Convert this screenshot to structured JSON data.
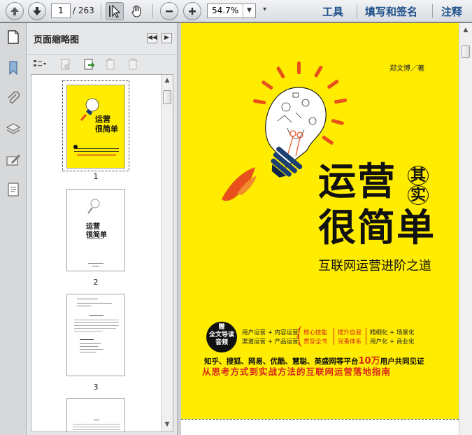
{
  "toolbar": {
    "current_page": "1",
    "page_total": "/ 263",
    "zoom": "54.7%",
    "tools_label": "工具",
    "sign_label": "填写和签名",
    "comment_label": "注释"
  },
  "panel": {
    "title": "页面缩略图",
    "thumbnails": [
      {
        "number": "1"
      },
      {
        "number": "2"
      },
      {
        "number": "3"
      }
    ],
    "thumb1_title_a": "运营",
    "thumb1_title_b": "很简单",
    "thumb2_title_a": "运营",
    "thumb2_title_b": "很简单"
  },
  "cover": {
    "author": "郑文博／著",
    "title_line1": "运营",
    "title_qi": "其",
    "title_shi": "实",
    "title_line2": "很简单",
    "subtitle": "互联网运营进阶之道",
    "badge_line1": "赠",
    "badge_line2": "全文导读",
    "badge_line3": "音频",
    "feature_left_1": "用户运营 + 内容运营",
    "feature_left_2": "渠道运营 + 产品运营",
    "feature_mid_1": "核心技能",
    "feature_mid_2": "贯穿全书",
    "feature_red_1": "提升自我",
    "feature_red_2": "完善体系",
    "feature_right_1": "精细化 + 场景化",
    "feature_right_2": "用户化 + 商业化",
    "tagline_a": "知乎、搜狐、网易、优酷、慧聪、英盛网等平台",
    "tagline_b": "10万",
    "tagline_c": "用户共同见证",
    "tagline2": "从思考方式到实战方法的互联网运营落地指南"
  },
  "colors": {
    "cover_yellow": "#ffec00",
    "accent_red": "#d8261b",
    "toolbar_link": "#1d4f8a"
  }
}
